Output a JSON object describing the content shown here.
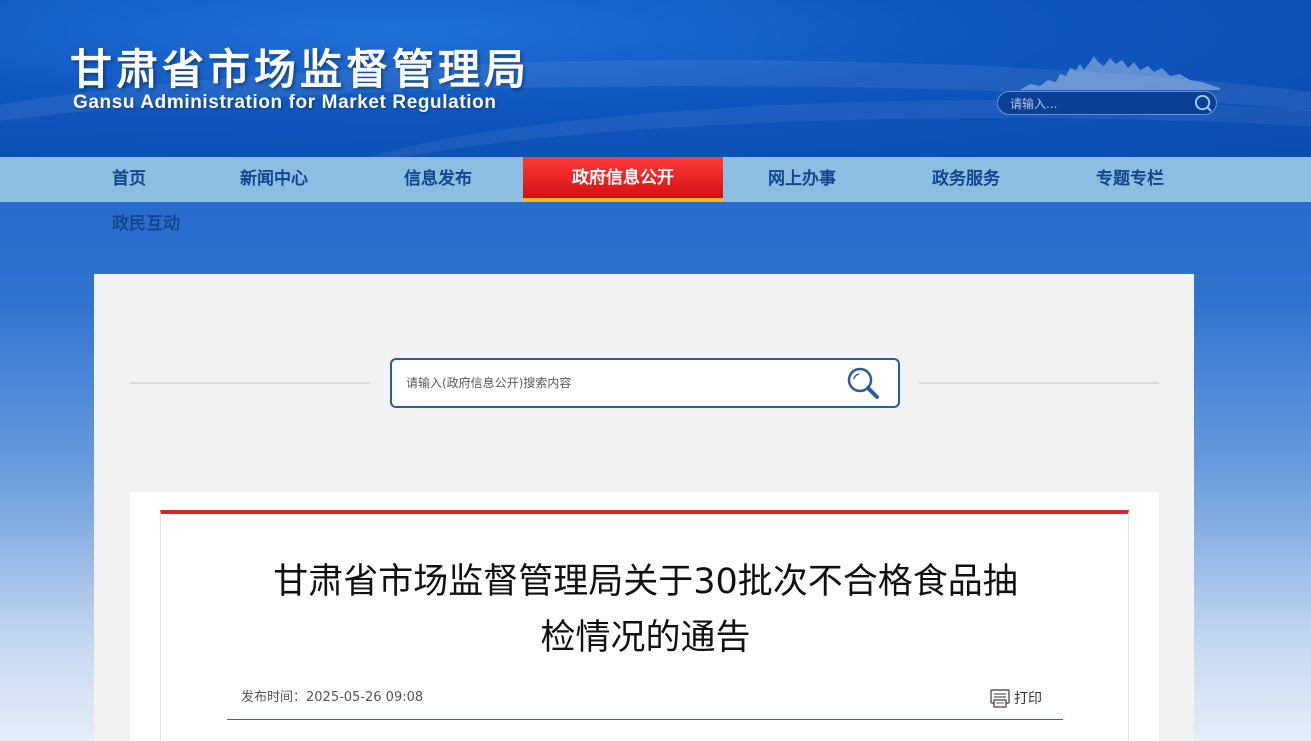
{
  "header": {
    "title": "甘肃省市场监督管理局",
    "subtitle": "Gansu Administration for Market Regulation",
    "search_placeholder": "请输入..."
  },
  "nav": {
    "items": [
      {
        "label": "首页",
        "active": false
      },
      {
        "label": "新闻中心",
        "active": false
      },
      {
        "label": "信息发布",
        "active": false
      },
      {
        "label": "政府信息公开",
        "active": true
      },
      {
        "label": "网上办事",
        "active": false
      },
      {
        "label": "政务服务",
        "active": false
      },
      {
        "label": "专题专栏",
        "active": false
      },
      {
        "label": "政民互动",
        "active": false
      }
    ]
  },
  "content_search": {
    "placeholder": "请输入(政府信息公开)搜索内容"
  },
  "article": {
    "title_line1": "甘肃省市场监督管理局关于30批次不合格食品抽",
    "title_line2": "检情况的通告",
    "publish_time": "发布时间：2025-05-26 09:08",
    "print_label": "打印"
  },
  "colors": {
    "header_blue": "#0f56bd",
    "nav_bg": "#8dbde0",
    "nav_text": "#14458f",
    "active_red": "#d40f10",
    "accent_gold": "#f4b820",
    "article_border_red": "#d9282d"
  }
}
